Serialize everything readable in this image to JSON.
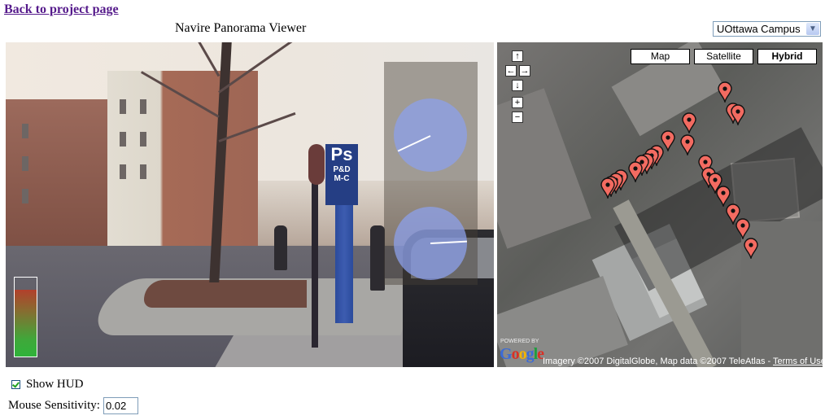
{
  "header": {
    "back_link": "Back to project page",
    "title": "Navire Panorama Viewer",
    "location_select": {
      "selected": "UOttawa Campus"
    }
  },
  "panorama": {
    "signs": {
      "parking_top": "Ps",
      "parking_mid": "P&D",
      "parking_bottom": "M-C"
    },
    "hud": {
      "compass_top_heading_deg": 245,
      "compass_bottom_heading_deg": 355,
      "gauge_level_fraction": 0.85
    }
  },
  "map": {
    "nav": {
      "up": "↑",
      "left": "←",
      "right": "→",
      "down": "↓",
      "zoom_in": "+",
      "zoom_out": "−"
    },
    "type_buttons": [
      {
        "label": "Map",
        "active": false
      },
      {
        "label": "Satellite",
        "active": false
      },
      {
        "label": "Hybrid",
        "active": true
      }
    ],
    "powered_by": "POWERED BY",
    "google_logo": "Google",
    "copyright": "Imagery ©2007 DigitalGlobe, Map data ©2007 TeleAtlas - ",
    "terms_link": "Terms of Use",
    "marker_color": "#f36b61",
    "marker_count": 22
  },
  "controls": {
    "show_hud_label": "Show HUD",
    "show_hud_checked": true,
    "mouse_sensitivity_label": "Mouse Sensitivity:",
    "mouse_sensitivity_value": "0.02"
  }
}
